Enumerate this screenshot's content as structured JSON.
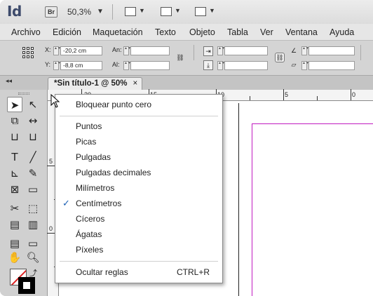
{
  "app": {
    "logo": "Id",
    "bridge_label": "Br",
    "zoom": "50,3%"
  },
  "menubar": [
    "Archivo",
    "Edición",
    "Maquetación",
    "Texto",
    "Objeto",
    "Tabla",
    "Ver",
    "Ventana",
    "Ayuda"
  ],
  "control": {
    "x_label": "X:",
    "x_value": "-20,2 cm",
    "y_label": "Y:",
    "y_value": "-8,8 cm",
    "w_label": "An:",
    "w_value": "",
    "h_label": "Al:",
    "h_value": ""
  },
  "document_tab": {
    "title": "*Sin título-1 @ 50%",
    "close": "×"
  },
  "ruler": {
    "h_labels": [
      "20",
      "15",
      "10",
      "5",
      "0"
    ],
    "v_labels": [
      "5",
      "0"
    ]
  },
  "context_menu": {
    "items": [
      {
        "label": "Bloquear punto cero",
        "shortcut": "",
        "checked": false
      },
      {
        "label": "Puntos",
        "shortcut": "",
        "checked": false
      },
      {
        "label": "Picas",
        "shortcut": "",
        "checked": false
      },
      {
        "label": "Pulgadas",
        "shortcut": "",
        "checked": false
      },
      {
        "label": "Pulgadas decimales",
        "shortcut": "",
        "checked": false
      },
      {
        "label": "Milímetros",
        "shortcut": "",
        "checked": false
      },
      {
        "label": "Centímetros",
        "shortcut": "",
        "checked": true
      },
      {
        "label": "Cíceros",
        "shortcut": "",
        "checked": false
      },
      {
        "label": "Ágatas",
        "shortcut": "",
        "checked": false
      },
      {
        "label": "Píxeles",
        "shortcut": "",
        "checked": false
      },
      {
        "label": "Ocultar reglas",
        "shortcut": "CTRL+R",
        "checked": false
      }
    ],
    "check_glyph": "✓"
  },
  "colors": {
    "accent": "#1a5fb4",
    "margin_guide": "#c01bc0",
    "logo": "#3d4a6b"
  }
}
